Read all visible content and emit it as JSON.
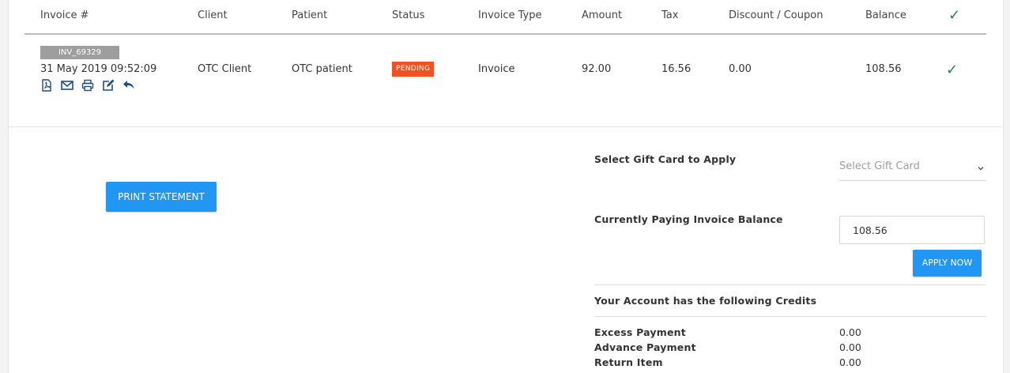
{
  "table": {
    "headers": {
      "invoice": "Invoice #",
      "client": "Client",
      "patient": "Patient",
      "status": "Status",
      "invoice_type": "Invoice Type",
      "amount": "Amount",
      "tax": "Tax",
      "discount": "Discount / Coupon",
      "balance": "Balance",
      "check": "✓"
    },
    "rows": [
      {
        "invoice_id": "INV_69329",
        "date": "31 May 2019 09:52:09",
        "client": "OTC Client",
        "patient": "OTC patient",
        "status": "PENDING",
        "invoice_type": "Invoice",
        "amount": "92.00",
        "tax": "16.56",
        "discount": "0.00",
        "balance": "108.56",
        "check": "✓",
        "action_icons": [
          "pdf-icon",
          "email-icon",
          "print-icon",
          "edit-icon",
          "reply-icon"
        ]
      }
    ]
  },
  "actions": {
    "print_statement": "PRINT STATEMENT",
    "apply_now": "APPLY NOW"
  },
  "payment": {
    "gift_card_label": "Select Gift Card to Apply",
    "gift_card_placeholder": "Select Gift Card",
    "paying_label": "Currently Paying Invoice Balance",
    "paying_value": "108.56"
  },
  "credits": {
    "heading": "Your Account has the following Credits",
    "items": [
      {
        "label": "Excess Payment",
        "value": "0.00"
      },
      {
        "label": "Advance Payment",
        "value": "0.00"
      },
      {
        "label": "Return Item",
        "value": "0.00"
      }
    ]
  },
  "colors": {
    "accent": "#2196f3",
    "status_pending": "#f4511e",
    "check": "#1e7b70",
    "badge": "#9e9e9e"
  }
}
